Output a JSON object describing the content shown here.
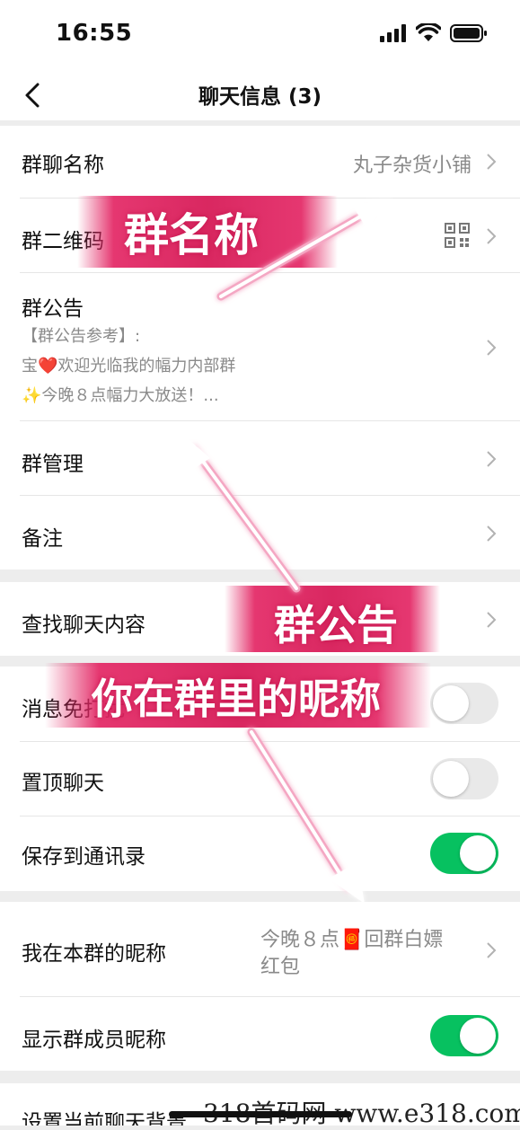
{
  "status_bar": {
    "time": "16:55"
  },
  "nav": {
    "title": "聊天信息 (3)"
  },
  "rows": {
    "group_name": {
      "label": "群聊名称",
      "value": "丸子杂货小铺"
    },
    "qr_code": {
      "label": "群二维码"
    },
    "notice": {
      "label": "群公告",
      "line1": "【群公告参考】:",
      "line2": "宝❤️欢迎光临我的幅力内部群",
      "line3": "✨今晚８点幅力大放送！..."
    },
    "manage": {
      "label": "群管理"
    },
    "remark": {
      "label": "备注"
    },
    "search": {
      "label": "查找聊天内容"
    },
    "mute": {
      "label": "消息免打扰",
      "on": false
    },
    "pin": {
      "label": "置顶聊天",
      "on": false
    },
    "save_contacts": {
      "label": "保存到通讯录",
      "on": true
    },
    "nickname": {
      "label": "我在本群的昵称",
      "value_line1": "今晚８点🧧回群白嫖",
      "value_line2": "红包"
    },
    "show_nicknames": {
      "label": "显示群成员昵称",
      "on": true
    },
    "background": {
      "label": "设置当前聊天背景"
    }
  },
  "overlays": {
    "group_name_tag": "群名称",
    "notice_tag": "群公告",
    "nickname_tag": "你在群里的昵称"
  },
  "watermark": "318首码网  www.e318.com",
  "colors": {
    "accent_green": "#07c160",
    "overlay_pink": "#e0266a"
  }
}
